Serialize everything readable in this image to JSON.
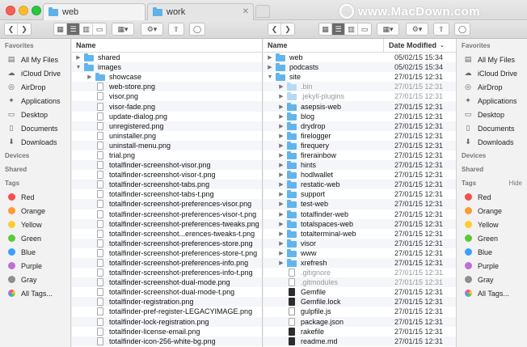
{
  "tabs": {
    "left": {
      "label": "web",
      "icon": "folder-icon"
    },
    "right": {
      "label": "work",
      "icon": "folder-icon"
    }
  },
  "watermark": "www.MacDown.com",
  "sidebar": {
    "favorites_label": "Favorites",
    "favorites": [
      {
        "label": "All My Files",
        "icon": "all-files-icon"
      },
      {
        "label": "iCloud Drive",
        "icon": "cloud-icon"
      },
      {
        "label": "AirDrop",
        "icon": "airdrop-icon"
      },
      {
        "label": "Applications",
        "icon": "applications-icon"
      },
      {
        "label": "Desktop",
        "icon": "desktop-icon"
      },
      {
        "label": "Documents",
        "icon": "documents-icon"
      },
      {
        "label": "Downloads",
        "icon": "downloads-icon"
      }
    ],
    "devices_label": "Devices",
    "shared_label": "Shared",
    "tags_label": "Tags",
    "hide_label": "Hide",
    "tags": [
      {
        "label": "Red",
        "color": "#fc4c4e"
      },
      {
        "label": "Orange",
        "color": "#fd9a2f"
      },
      {
        "label": "Yellow",
        "color": "#fecd30"
      },
      {
        "label": "Green",
        "color": "#5ac93c"
      },
      {
        "label": "Blue",
        "color": "#39a0fc"
      },
      {
        "label": "Purple",
        "color": "#c16fd6"
      },
      {
        "label": "Gray",
        "color": "#8e8e93"
      },
      {
        "label": "All Tags...",
        "color": "all"
      }
    ]
  },
  "left_pane": {
    "column_name": "Name",
    "rows": [
      {
        "name": "shared",
        "kind": "folder",
        "disc": "▶",
        "indent": 0
      },
      {
        "name": "images",
        "kind": "folder",
        "disc": "▼",
        "indent": 0
      },
      {
        "name": "showcase",
        "kind": "folder",
        "disc": "▶",
        "indent": 1
      },
      {
        "name": "web-store.png",
        "kind": "file",
        "disc": "",
        "indent": 1
      },
      {
        "name": "visor.png",
        "kind": "file",
        "disc": "",
        "indent": 1
      },
      {
        "name": "visor-fade.png",
        "kind": "file",
        "disc": "",
        "indent": 1
      },
      {
        "name": "update-dialog.png",
        "kind": "file",
        "disc": "",
        "indent": 1
      },
      {
        "name": "unregistered.png",
        "kind": "file",
        "disc": "",
        "indent": 1
      },
      {
        "name": "uninstaller.png",
        "kind": "file",
        "disc": "",
        "indent": 1
      },
      {
        "name": "uninstall-menu.png",
        "kind": "file",
        "disc": "",
        "indent": 1
      },
      {
        "name": "trial.png",
        "kind": "file",
        "disc": "",
        "indent": 1
      },
      {
        "name": "totalfinder-screenshot-visor.png",
        "kind": "file",
        "disc": "",
        "indent": 1
      },
      {
        "name": "totalfinder-screenshot-visor-t.png",
        "kind": "file",
        "disc": "",
        "indent": 1
      },
      {
        "name": "totalfinder-screenshot-tabs.png",
        "kind": "file",
        "disc": "",
        "indent": 1
      },
      {
        "name": "totalfinder-screenshot-tabs-t.png",
        "kind": "file",
        "disc": "",
        "indent": 1
      },
      {
        "name": "totalfinder-screenshot-preferences-visor.png",
        "kind": "file",
        "disc": "",
        "indent": 1
      },
      {
        "name": "totalfinder-screenshot-preferences-visor-t.png",
        "kind": "file",
        "disc": "",
        "indent": 1
      },
      {
        "name": "totalfinder-screenshot-preferences-tweaks.png",
        "kind": "file",
        "disc": "",
        "indent": 1
      },
      {
        "name": "totalfinder-screenshot...erences-tweaks-t.png",
        "kind": "file",
        "disc": "",
        "indent": 1
      },
      {
        "name": "totalfinder-screenshot-preferences-store.png",
        "kind": "file",
        "disc": "",
        "indent": 1
      },
      {
        "name": "totalfinder-screenshot-preferences-store-t.png",
        "kind": "file",
        "disc": "",
        "indent": 1
      },
      {
        "name": "totalfinder-screenshot-preferences-info.png",
        "kind": "file",
        "disc": "",
        "indent": 1
      },
      {
        "name": "totalfinder-screenshot-preferences-info-t.png",
        "kind": "file",
        "disc": "",
        "indent": 1
      },
      {
        "name": "totalfinder-screenshot-dual-mode.png",
        "kind": "file",
        "disc": "",
        "indent": 1
      },
      {
        "name": "totalfinder-screenshot-dual-mode-t.png",
        "kind": "file",
        "disc": "",
        "indent": 1
      },
      {
        "name": "totalfinder-registration.png",
        "kind": "file",
        "disc": "",
        "indent": 1
      },
      {
        "name": "totalfinder-pref-register-LEGACYIMAGE.png",
        "kind": "file",
        "disc": "",
        "indent": 1
      },
      {
        "name": "totalfinder-lock-registration.png",
        "kind": "file",
        "disc": "",
        "indent": 1
      },
      {
        "name": "totalfinder-license-email.png",
        "kind": "file",
        "disc": "",
        "indent": 1
      },
      {
        "name": "totalfinder-icon-256-white-bg.png",
        "kind": "file",
        "disc": "",
        "indent": 1
      }
    ]
  },
  "right_pane": {
    "column_name": "Name",
    "column_date": "Date Modified",
    "rows": [
      {
        "name": "web",
        "kind": "folder",
        "disc": "▶",
        "indent": 0,
        "date": "05/02/15 15:34"
      },
      {
        "name": "podcasts",
        "kind": "folder",
        "disc": "▶",
        "indent": 0,
        "date": "05/02/15 15:34"
      },
      {
        "name": "site",
        "kind": "folder",
        "disc": "▼",
        "indent": 0,
        "date": "27/01/15 12:31"
      },
      {
        "name": ".bin",
        "kind": "folder-dim",
        "disc": "▶",
        "indent": 1,
        "date": "27/01/15 12:31"
      },
      {
        "name": ".jekyll-plugins",
        "kind": "folder-dim",
        "disc": "▶",
        "indent": 1,
        "date": "27/01/15 12:31"
      },
      {
        "name": "asepsis-web",
        "kind": "folder",
        "disc": "▶",
        "indent": 1,
        "date": "27/01/15 12:31"
      },
      {
        "name": "blog",
        "kind": "folder",
        "disc": "▶",
        "indent": 1,
        "date": "27/01/15 12:31"
      },
      {
        "name": "drydrop",
        "kind": "folder",
        "disc": "▶",
        "indent": 1,
        "date": "27/01/15 12:31"
      },
      {
        "name": "firelogger",
        "kind": "folder",
        "disc": "▶",
        "indent": 1,
        "date": "27/01/15 12:31"
      },
      {
        "name": "firequery",
        "kind": "folder",
        "disc": "▶",
        "indent": 1,
        "date": "27/01/15 12:31"
      },
      {
        "name": "firerainbow",
        "kind": "folder",
        "disc": "▶",
        "indent": 1,
        "date": "27/01/15 12:31"
      },
      {
        "name": "hints",
        "kind": "folder",
        "disc": "▶",
        "indent": 1,
        "date": "27/01/15 12:31"
      },
      {
        "name": "hodlwallet",
        "kind": "folder",
        "disc": "▶",
        "indent": 1,
        "date": "27/01/15 12:31"
      },
      {
        "name": "restatic-web",
        "kind": "folder",
        "disc": "▶",
        "indent": 1,
        "date": "27/01/15 12:31"
      },
      {
        "name": "support",
        "kind": "folder",
        "disc": "▶",
        "indent": 1,
        "date": "27/01/15 12:31"
      },
      {
        "name": "test-web",
        "kind": "folder",
        "disc": "▶",
        "indent": 1,
        "date": "27/01/15 12:31"
      },
      {
        "name": "totalfinder-web",
        "kind": "folder",
        "disc": "▶",
        "indent": 1,
        "date": "27/01/15 12:31"
      },
      {
        "name": "totalspaces-web",
        "kind": "folder",
        "disc": "▶",
        "indent": 1,
        "date": "27/01/15 12:31"
      },
      {
        "name": "totalterminal-web",
        "kind": "folder",
        "disc": "▶",
        "indent": 1,
        "date": "27/01/15 12:31"
      },
      {
        "name": "visor",
        "kind": "folder",
        "disc": "▶",
        "indent": 1,
        "date": "27/01/15 12:31"
      },
      {
        "name": "www",
        "kind": "folder",
        "disc": "▶",
        "indent": 1,
        "date": "27/01/15 12:31"
      },
      {
        "name": "xrefresh",
        "kind": "folder",
        "disc": "▶",
        "indent": 1,
        "date": "27/01/15 12:31"
      },
      {
        "name": ".gitignore",
        "kind": "file-dim",
        "disc": "",
        "indent": 1,
        "date": "27/01/15 12:31"
      },
      {
        "name": ".gitmodules",
        "kind": "file-dim",
        "disc": "",
        "indent": 1,
        "date": "27/01/15 12:31"
      },
      {
        "name": "Gemfile",
        "kind": "file-dark",
        "disc": "",
        "indent": 1,
        "date": "27/01/15 12:31"
      },
      {
        "name": "Gemfile.lock",
        "kind": "file-dark",
        "disc": "",
        "indent": 1,
        "date": "27/01/15 12:31"
      },
      {
        "name": "gulpfile.js",
        "kind": "file-js",
        "disc": "",
        "indent": 1,
        "date": "27/01/15 12:31"
      },
      {
        "name": "package.json",
        "kind": "file",
        "disc": "",
        "indent": 1,
        "date": "27/01/15 12:31"
      },
      {
        "name": "rakefile",
        "kind": "file-dark",
        "disc": "",
        "indent": 1,
        "date": "27/01/15 12:31"
      },
      {
        "name": "readme.md",
        "kind": "file-dark",
        "disc": "",
        "indent": 1,
        "date": "27/01/15 12:31"
      }
    ]
  }
}
